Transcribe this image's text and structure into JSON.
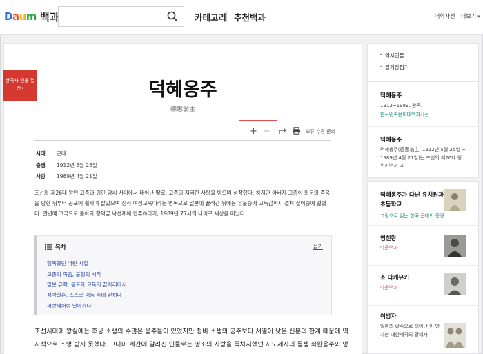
{
  "header": {
    "logo_prefix": "D",
    "logo_a": "a",
    "logo_u": "u",
    "logo_m": "m",
    "section": "백과",
    "search_placeholder": "",
    "nav": [
      "카테고리",
      "추천백과"
    ],
    "right_links": [
      "어학사전",
      "더보기"
    ]
  },
  "banner": {
    "text": "한국사 인물 열전"
  },
  "article": {
    "title": "덕혜옹주",
    "hanja": "德惠翁主",
    "tools": {
      "zoom_in": "+",
      "zoom_out": "−",
      "report": "오류 수정 문의"
    },
    "info": [
      {
        "key": "시대",
        "value": "근대"
      },
      {
        "key": "출생",
        "value": "1912년 5월 25일"
      },
      {
        "key": "사망",
        "value": "1989년 4월 21일"
      }
    ],
    "summary": "조선의 제26대 왕인 고종과 귀인 양씨 사이에서 태어난 딸로, 고종의 지극한 사랑을 받으며 성장했다. 하지만 아버지 고종이 의문의 죽음을 당한 뒤부터 공포에 휩싸여 살았으며 신식 여성교육이라는 명목으로 일본에 끌려간 뒤에는 우울증에 고독감까지 겹쳐 실어증에 걸렸다. 말년에 고국으로 돌아와 창덕궁 낙선재에 안주하다가, 1989년 77세의 나이로 세상을 떠났다.",
    "toc": {
      "title": "목차",
      "fold": "접기",
      "items": [
        "행복했던 어린 시절",
        "고종의 죽음, 불행의 시작",
        "일본 유학, 공포와 고독의 끝자리에서",
        "정략결혼, 스스로 어둠 속에 갇히다",
        "파랑새처럼 날아가다"
      ]
    },
    "body": "조선시대에 왕실에는 후궁 소생의 수많은 옹주들이 있었지만 정비 소생의 공주보다 서열이 낮은 신분의 한계 때문에 역사적으로 조명 받지 못했다. 그나마 세간에 알려진 인물로는 영조의 사랑을 독차지했던 사도세자의 동생 화완옹주와 망국의"
  },
  "rail": {
    "links": [
      "역사인물",
      "일제강점기"
    ],
    "entries": [
      {
        "title": "덕혜옹주",
        "sub": "1912~1989. 왕족.",
        "src": "한국민족문화대백과사전"
      },
      {
        "title": "덕혜옹주",
        "sub": "덕혜옹주(德惠翁主, 1912년 5월 25일 ~ 1989년 4월 21일)는 조선의 제26대 왕",
        "src": "위키백과 ⊡"
      }
    ],
    "related": [
      {
        "title": "덕혜옹주가 다닌 유치원과 초등학교",
        "src": "그림으로 읽는 한국 근대의 풍경",
        "src_color": "teal"
      },
      {
        "title": "영친왕",
        "src": "다음백과",
        "src_color": "red"
      },
      {
        "title": "소 다케유키",
        "src": "다음백과",
        "src_color": "red"
      },
      {
        "title": "이방자",
        "sub": "일본의 황족으로 태어난 이 방자는 대한제국의 황태자",
        "src": "",
        "src_color": "red"
      }
    ]
  },
  "colors": {
    "accent_red": "#d4382e",
    "link_blue": "#2e4a9e",
    "teal": "#1a8a82"
  }
}
